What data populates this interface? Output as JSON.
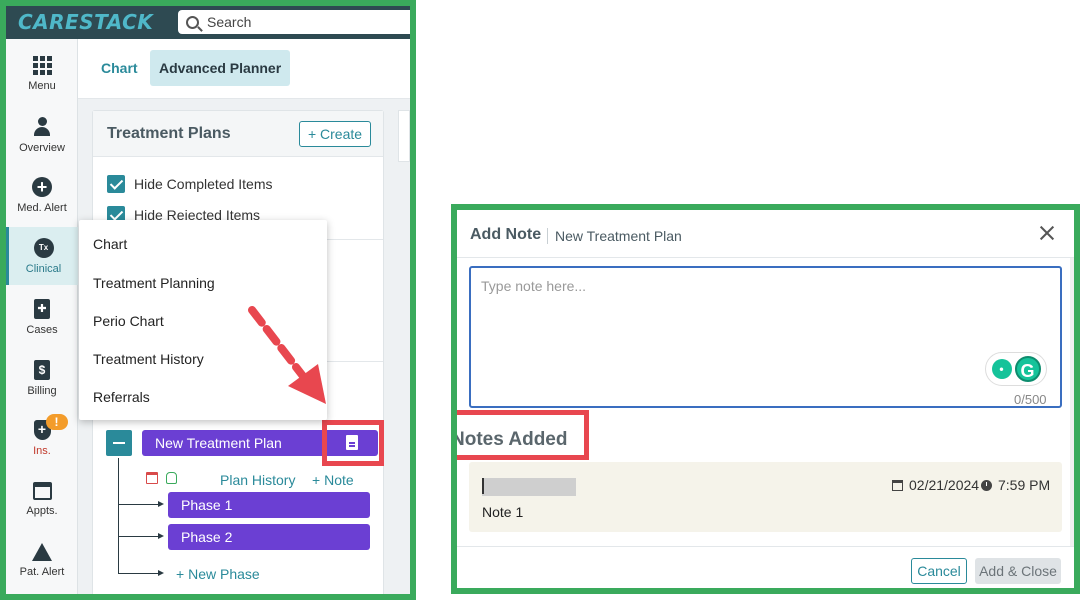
{
  "app": {
    "logo": "CARESTACK"
  },
  "search": {
    "label": "Search"
  },
  "sidebar": {
    "items": [
      {
        "label": "Menu",
        "icon": "grid-icon"
      },
      {
        "label": "Overview",
        "icon": "person-icon"
      },
      {
        "label": "Med. Alert",
        "icon": "plus-circle-icon"
      },
      {
        "label": "Clinical",
        "icon": "tx-icon",
        "tx": "Tx"
      },
      {
        "label": "Cases",
        "icon": "clipboard-icon"
      },
      {
        "label": "Billing",
        "icon": "dollar-document-icon",
        "symbol": "$"
      },
      {
        "label": "Ins.",
        "icon": "shield-plus-icon",
        "badge": "!"
      },
      {
        "label": "Appts.",
        "icon": "calendar-icon"
      },
      {
        "label": "Pat. Alert",
        "icon": "alert-triangle-icon"
      }
    ]
  },
  "subnav": {
    "tab_chart": "Chart",
    "tab_advanced": "Advanced Planner"
  },
  "treatment_plans": {
    "title": "Treatment Plans",
    "create_label": "Create",
    "hide_completed": "Hide Completed Items",
    "hide_rejected": "Hide Rejected Items",
    "plan_name": "New Treatment Plan",
    "plan_history": "Plan History",
    "note_label": "Note",
    "phases": [
      "Phase 1",
      "Phase 2"
    ],
    "new_phase": "New Phase"
  },
  "clinical_menu": {
    "items": [
      "Chart",
      "Treatment Planning",
      "Perio Chart",
      "Treatment History",
      "Referrals"
    ]
  },
  "modal": {
    "title": "Add Note",
    "subtitle": "New Treatment Plan",
    "placeholder": "Type note here...",
    "char_count": "0/500",
    "notes_added_heading": "Notes Added",
    "note": {
      "date": "02/21/2024",
      "time": "7:59 PM",
      "text": "Note 1"
    },
    "cancel_label": "Cancel",
    "add_close_label": "Add & Close"
  },
  "colors": {
    "frame_green": "#3aaa5c",
    "highlight_red": "#e8474f",
    "plan_purple": "#6b3fd3",
    "accent_teal": "#2a8a9a"
  }
}
